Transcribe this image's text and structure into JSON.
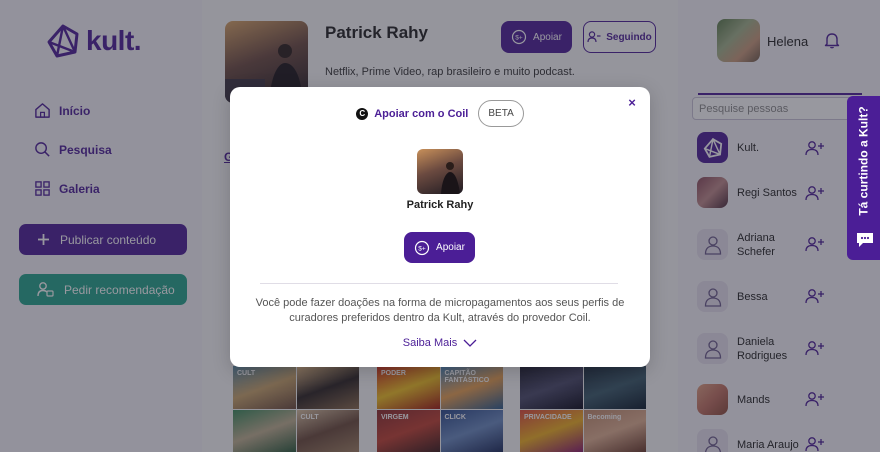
{
  "brand": {
    "name": "kult."
  },
  "nav": {
    "items": [
      {
        "label": "Início",
        "icon": "home-icon"
      },
      {
        "label": "Pesquisa",
        "icon": "search-icon"
      },
      {
        "label": "Galeria",
        "icon": "grid-icon"
      }
    ],
    "publish_label": "Publicar conteúdo",
    "recommend_label": "Pedir recomendação"
  },
  "profile": {
    "name": "Patrick Rahy",
    "bio": "Netflix, Prime Video, rap brasileiro e muito podcast.",
    "apoiar_label": "Apoiar",
    "seguindo_label": "Seguindo",
    "tab_fragment": "G"
  },
  "posters": {
    "col1": [
      "CULT",
      "",
      "",
      "CULT"
    ],
    "col2": [
      "PODER",
      "CAPITÃO FANTÁSTICO",
      "VIRGEM",
      "CLICK"
    ],
    "col3": [
      "",
      "",
      "PRIVACIDADE",
      "Becoming"
    ]
  },
  "user": {
    "name": "Helena"
  },
  "search": {
    "placeholder": "Pesquise pessoas"
  },
  "people": [
    {
      "name": "Kult.",
      "avatar": "kult-logo"
    },
    {
      "name": "Regi Santos",
      "avatar": "photo"
    },
    {
      "name": "Adriana Schefer",
      "avatar": "placeholder"
    },
    {
      "name": "Bessa",
      "avatar": "placeholder"
    },
    {
      "name": "Daniela Rodrigues",
      "avatar": "placeholder"
    },
    {
      "name": "Mands",
      "avatar": "photo"
    },
    {
      "name": "Maria Araujo",
      "avatar": "placeholder"
    }
  ],
  "feedback_tab": {
    "label": "Tá curtindo a Kult?"
  },
  "modal": {
    "title": "Apoiar com o Coil",
    "coil_glyph": "C",
    "badge": "BETA",
    "close_glyph": "×",
    "name": "Patrick Rahy",
    "apoiar_label": "Apoiar",
    "description": "Você pode fazer doações na forma de micropagamentos aos seus perfis de curadores preferidos dentro da Kult, através do provedor Coil.",
    "saiba_mais_label": "Saiba Mais"
  },
  "colors": {
    "brand_purple": "#4b1e96",
    "green": "#23a48a",
    "overlay": "rgba(40,40,55,0.48)"
  }
}
